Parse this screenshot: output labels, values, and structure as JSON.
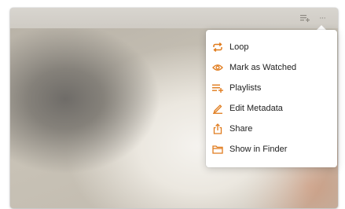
{
  "colors": {
    "accent": "#e07b1c",
    "menu_bg": "#ffffff",
    "topbar_icon": "#8e8a83"
  },
  "topbar": {
    "buttons": [
      {
        "icon": "add-to-playlist-icon"
      },
      {
        "icon": "more-options-icon",
        "label": "···"
      }
    ]
  },
  "menu": {
    "items": [
      {
        "label": "Loop",
        "icon": "loop-icon"
      },
      {
        "label": "Mark as Watched",
        "icon": "eye-icon"
      },
      {
        "label": "Playlists",
        "icon": "playlist-add-icon"
      },
      {
        "label": "Edit Metadata",
        "icon": "pencil-icon"
      },
      {
        "label": "Share",
        "icon": "share-icon"
      },
      {
        "label": "Show in Finder",
        "icon": "folder-icon"
      }
    ]
  }
}
